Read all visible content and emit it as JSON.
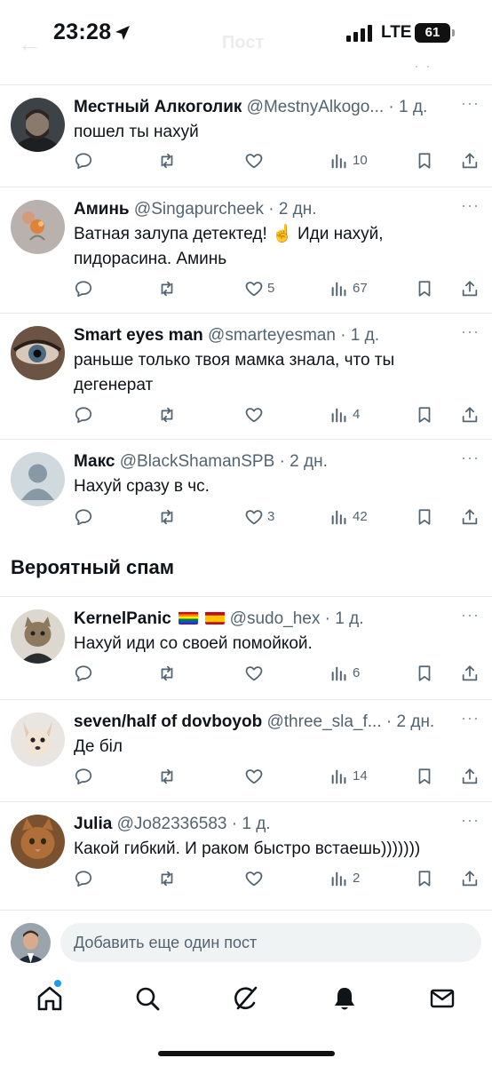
{
  "status_bar": {
    "time": "23:28",
    "network": "LTE",
    "battery": "61"
  },
  "nav": {
    "title": "Пост",
    "more": "· ·"
  },
  "posts": [
    {
      "name": "Местный Алкоголик",
      "handle": "@MestnyAlkogo...",
      "time": "· 1 д.",
      "text": "пошел ты нахуй",
      "likes": "",
      "views": "10",
      "avatar_icon": "bearded-man-avatar-icon"
    },
    {
      "name": "Аминь",
      "handle": "@Singapurcheek",
      "time": "· 2 дн.",
      "text": "Ватная залупа детектед! ☝ Иди нахуй, пидорасина. Аминь",
      "likes": "5",
      "views": "67",
      "avatar_icon": "flower-avatar-icon"
    },
    {
      "name": "Smart eyes man",
      "handle": "@smarteyesman",
      "time": "· 1 д.",
      "text": "раньше только твоя мамка знала, что ты дегенерат",
      "likes": "",
      "views": "4",
      "avatar_icon": "eye-avatar-icon"
    },
    {
      "name": "Макс",
      "handle": "@BlackShamanSPB",
      "time": "· 2 дн.",
      "text": "Нахуй сразу в чс.",
      "likes": "3",
      "views": "42",
      "avatar_icon": "default-profile-icon"
    }
  ],
  "spam_section": {
    "title": "Вероятный спам"
  },
  "spam_posts": [
    {
      "name": "KernelPanic",
      "handle": "@sudo_hex",
      "time": "· 1 д.",
      "text": "Нахуй иди со своей помойкой.",
      "likes": "",
      "views": "6",
      "avatar_icon": "cat-in-suit-avatar-icon"
    },
    {
      "name": "seven/half of dovboyob",
      "handle": "@three_sla_f...",
      "time": "· 2 дн.",
      "text": "Де біл",
      "likes": "",
      "views": "14",
      "avatar_icon": "chihuahua-avatar-icon"
    },
    {
      "name": "Julia",
      "handle": "@Jo82336583",
      "time": "· 1 д.",
      "text": "Какой гибкий. И раком быстро встаешь)))))))",
      "likes": "",
      "views": "2",
      "avatar_icon": "cat-avatar-icon"
    }
  ],
  "reply": {
    "placeholder": "Добавить еще один пост"
  },
  "tabs": [
    "home-icon",
    "search-icon",
    "grok-icon",
    "notifications-icon",
    "messages-icon"
  ],
  "colors": {
    "text": "#0f1419",
    "secondary": "#536471",
    "divider": "#e6e9eb",
    "accent": "#1d9bf0",
    "input_bg": "#eff3f4"
  }
}
